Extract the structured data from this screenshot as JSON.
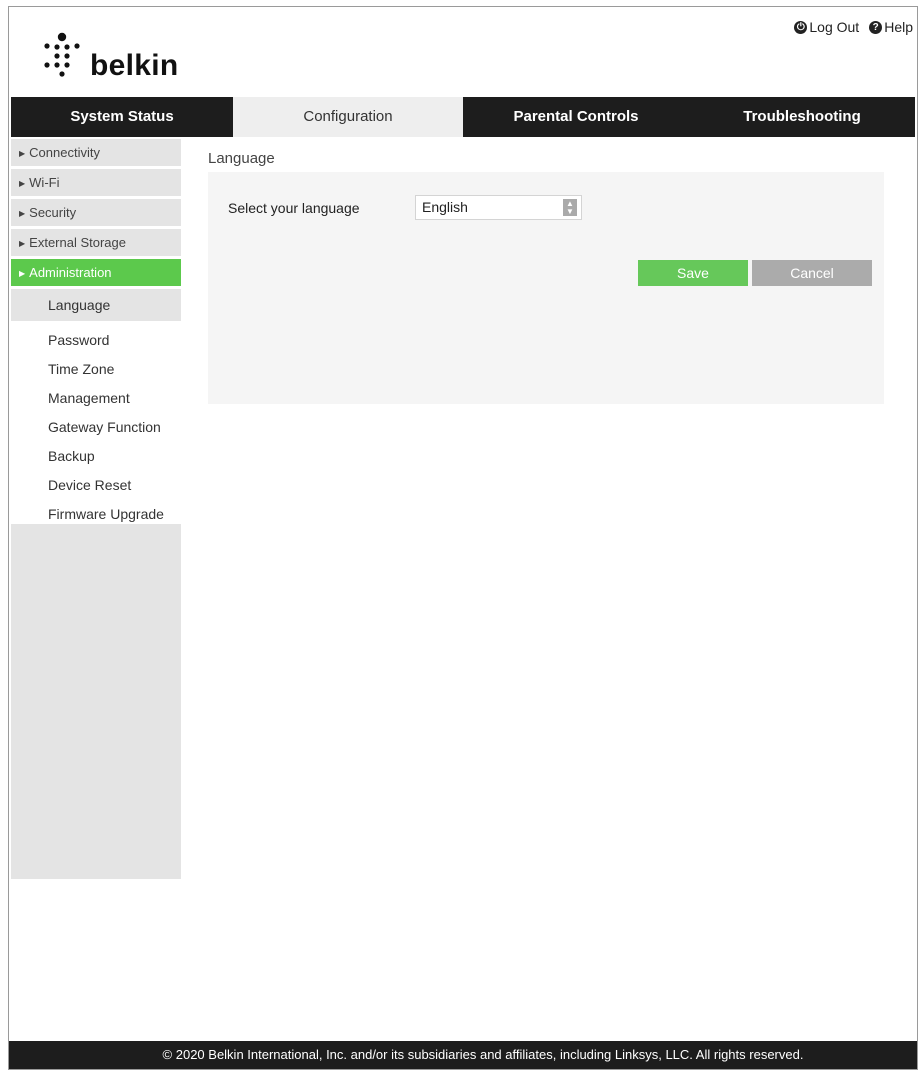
{
  "header": {
    "brand": "belkin",
    "logout_label": "Log Out",
    "help_label": "Help"
  },
  "nav": {
    "tabs": [
      {
        "label": "System Status",
        "active": false
      },
      {
        "label": "Configuration",
        "active": true
      },
      {
        "label": "Parental Controls",
        "active": false
      },
      {
        "label": "Troubleshooting",
        "active": false
      }
    ]
  },
  "sidebar": {
    "sections": [
      {
        "label": "Connectivity"
      },
      {
        "label": "Wi-Fi"
      },
      {
        "label": "Security"
      },
      {
        "label": "External Storage"
      },
      {
        "label": "Administration"
      }
    ],
    "sub_items": [
      {
        "label": "Language"
      },
      {
        "label": "Password"
      },
      {
        "label": "Time Zone"
      },
      {
        "label": "Management"
      },
      {
        "label": "Gateway Function"
      },
      {
        "label": "Backup"
      },
      {
        "label": "Device Reset"
      },
      {
        "label": "Firmware Upgrade"
      }
    ]
  },
  "main": {
    "title": "Language",
    "select_label": "Select your language",
    "selected_language": "English",
    "save_label": "Save",
    "cancel_label": "Cancel"
  },
  "footer": {
    "copyright": "© 2020 Belkin International, Inc. and/or its subsidiaries and affiliates, including Linksys, LLC. All rights reserved."
  },
  "colors": {
    "accent_green": "#5cc94c",
    "nav_dark": "#1d1d1d",
    "cancel_gray": "#ababab"
  }
}
